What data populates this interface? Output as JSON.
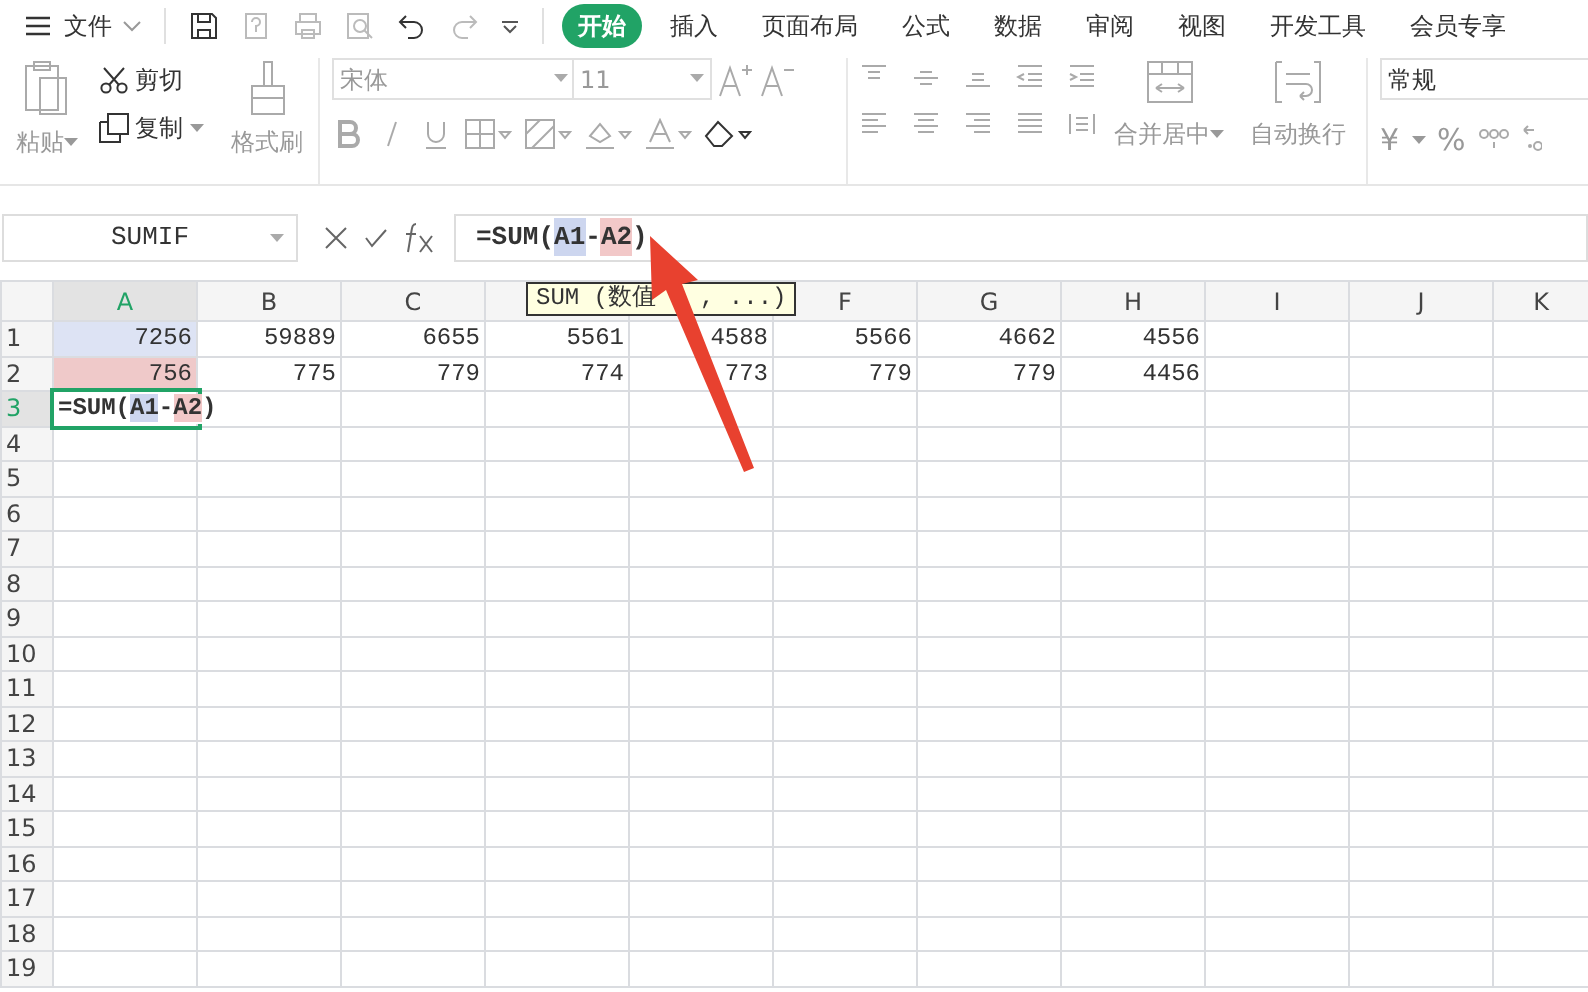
{
  "menu": {
    "label": "文件"
  },
  "tabs": [
    {
      "label": "开始",
      "selected": true
    },
    {
      "label": "插入",
      "selected": false
    },
    {
      "label": "页面布局",
      "selected": false
    },
    {
      "label": "公式",
      "selected": false
    },
    {
      "label": "数据",
      "selected": false
    },
    {
      "label": "审阅",
      "selected": false
    },
    {
      "label": "视图",
      "selected": false
    },
    {
      "label": "开发工具",
      "selected": false
    },
    {
      "label": "会员专享",
      "selected": false
    }
  ],
  "clipboard": {
    "paste": "粘贴",
    "cut": "剪切",
    "copy": "复制",
    "format_painter": "格式刷"
  },
  "font": {
    "name": "宋体",
    "size": "11"
  },
  "alignment": {
    "merge": "合并居中",
    "wrap": "自动换行"
  },
  "number": {
    "format": "常规",
    "currency": "¥",
    "percent": "%"
  },
  "formula_bar": {
    "name_box": "SUMIF",
    "formula": [
      {
        "text": "=SUM("
      },
      {
        "text": "A1",
        "color": "#cdd6ef"
      },
      {
        "text": "-"
      },
      {
        "text": "A2",
        "color": "#f2c8c8"
      },
      {
        "text": ")"
      }
    ]
  },
  "tooltip": [
    "SUM (数值",
    ", ...)"
  ],
  "columns": [
    {
      "label": "A",
      "selected": true
    },
    {
      "label": "B",
      "selected": false
    },
    {
      "label": "C",
      "selected": false
    },
    {
      "selected": false
    },
    {
      "selected": false
    },
    {
      "label": "F",
      "selected": false
    },
    {
      "label": "G",
      "selected": false
    },
    {
      "label": "H",
      "selected": false
    },
    {
      "label": "I",
      "selected": false
    },
    {
      "label": "J",
      "selected": false
    },
    {
      "label": "K",
      "selected": false
    }
  ],
  "rows": [
    {
      "label": "1",
      "selected": false,
      "cells": [
        {
          "text": "7256",
          "color": "#dde3f4"
        },
        {
          "text": "59889"
        },
        {
          "text": "6655"
        },
        {
          "text": "5561"
        },
        {
          "text": "4588"
        },
        {
          "text": "5566"
        },
        {
          "text": "4662"
        },
        {
          "text": "4556"
        }
      ]
    },
    {
      "label": "2",
      "selected": false,
      "cells": [
        {
          "text": "756",
          "color": "#efc9c9"
        },
        {
          "text": "775"
        },
        {
          "text": "779"
        },
        {
          "text": "774"
        },
        {
          "text": "773"
        },
        {
          "text": "779"
        },
        {
          "text": "779"
        },
        {
          "text": "4456"
        }
      ]
    },
    {
      "label": "3",
      "selected": true,
      "cells": [
        {
          "formula": [
            {
              "text": "=SUM("
            },
            {
              "text": "A1",
              "color": "#cdd6ef"
            },
            {
              "text": "-"
            },
            {
              "text": "A2",
              "color": "#f2c8c8"
            },
            {
              "text": ")"
            }
          ]
        }
      ]
    },
    {
      "label": "4",
      "selected": false,
      "cells": []
    },
    {
      "label": "5",
      "selected": false,
      "cells": []
    },
    {
      "label": "6",
      "selected": false,
      "cells": []
    },
    {
      "label": "7",
      "selected": false,
      "cells": []
    },
    {
      "label": "8",
      "selected": false,
      "cells": []
    },
    {
      "label": "9",
      "selected": false,
      "cells": []
    },
    {
      "label": "10",
      "selected": false,
      "cells": []
    },
    {
      "label": "11",
      "selected": false,
      "cells": []
    },
    {
      "label": "12",
      "selected": false,
      "cells": []
    },
    {
      "label": "13",
      "selected": false,
      "cells": []
    },
    {
      "label": "14",
      "selected": false,
      "cells": []
    },
    {
      "label": "15",
      "selected": false,
      "cells": []
    },
    {
      "label": "16",
      "selected": false,
      "cells": []
    },
    {
      "label": "17",
      "selected": false,
      "cells": []
    },
    {
      "label": "18",
      "selected": false,
      "cells": []
    },
    {
      "label": "19",
      "selected": false,
      "cells": []
    }
  ]
}
